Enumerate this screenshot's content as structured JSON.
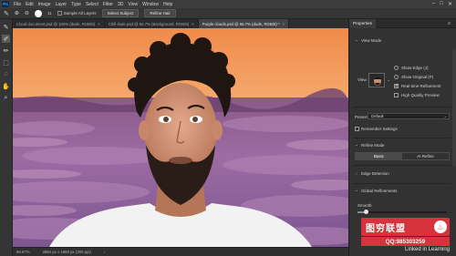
{
  "menubar": {
    "logo": "Ps",
    "items": [
      "File",
      "Edit",
      "Image",
      "Layer",
      "Type",
      "Select",
      "Filter",
      "3D",
      "View",
      "Window",
      "Help"
    ],
    "window_controls": [
      "–",
      "□",
      "✕"
    ]
  },
  "options": {
    "brush_size": "11",
    "sample_all_layers": "Sample All Layers",
    "select_subject": "Select Subject",
    "refine_hair": "Refine Hair"
  },
  "tabs": [
    {
      "label": "Cloud document.psd @ 100% (dude, RGB/8)"
    },
    {
      "label": "Chill dude.psd @ 66.7% (Background, RGB/8)"
    },
    {
      "label": "Purple clouds.psd @ 66.7% (dude, RGB/8) *"
    }
  ],
  "tab_close": "×",
  "status": {
    "zoom": "66.67%",
    "doc_size": "2884 px x 1980 px (300 ppi)",
    "arrow": "›"
  },
  "panel": {
    "tab": "Properties",
    "menu": "≡",
    "view_mode": "View Mode",
    "view_label": "View:",
    "show_edge": "Show Edge (J)",
    "show_original": "Show Original (P)",
    "realtime_refinement": "Real-time Refinement",
    "high_quality_preview": "High Quality Preview",
    "preset_label": "Preset:",
    "preset_value": "Default",
    "remember_settings": "Remember Settings",
    "refine_mode": "Refine Mode",
    "basic": "Basic",
    "ai_refine": "AI Refine",
    "edge_detection": "Edge Detection",
    "global_refinements": "Global Refinements",
    "smooth_label": "Smooth",
    "smooth_level": 0.1,
    "chevron": "⌄",
    "chevron_right": "›"
  },
  "watermark": {
    "brand": "图穷联盟",
    "qq": "QQ:985303259",
    "linkedin": "Linked in Learning"
  }
}
